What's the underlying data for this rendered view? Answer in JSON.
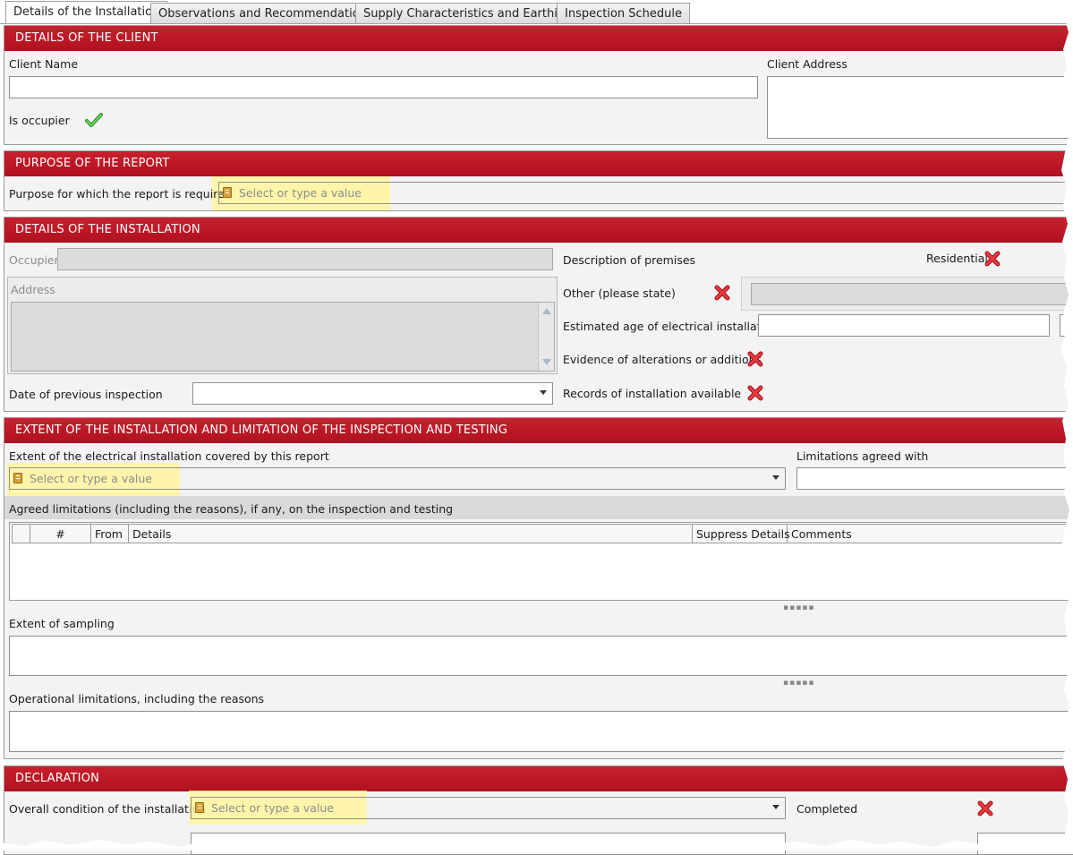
{
  "tabs": [
    {
      "label": "Details of the Installation",
      "active": true
    },
    {
      "label": "Observations and Recommendations",
      "active": false
    },
    {
      "label": "Supply Characteristics and Earthing",
      "active": false
    },
    {
      "label": "Inspection Schedule",
      "active": false
    }
  ],
  "client": {
    "header": "DETAILS OF THE CLIENT",
    "name_label": "Client Name",
    "name_value": "",
    "address_label": "Client Address",
    "address_value": "",
    "occupier_label": "Is occupier",
    "occupier_checked": true
  },
  "purpose": {
    "header": "PURPOSE OF THE REPORT",
    "label": "Purpose for which the report is required",
    "placeholder": "Select or type a value"
  },
  "installation": {
    "header": "DETAILS OF THE INSTALLATION",
    "occupier_label": "Occupier",
    "address_label": "Address",
    "prev_inspection_label": "Date of previous inspection",
    "prev_inspection_value": "",
    "premises_label": "Description of premises",
    "residential_label": "Residential",
    "other_label": "Other (please state)",
    "age_label": "Estimated age of electrical installation",
    "age_value": "",
    "alterations_label": "Evidence of alterations or additions",
    "records_label": "Records of installation available"
  },
  "extent": {
    "header": "EXTENT OF THE INSTALLATION AND LIMITATION OF THE INSPECTION AND TESTING",
    "covered_label": "Extent of the electrical installation covered by this report",
    "covered_placeholder": "Select or type a value",
    "agreed_with_label": "Limitations agreed with",
    "agreed_limitations_label": "Agreed limitations (including the reasons), if any, on the inspection and testing",
    "columns": [
      "#",
      "From",
      "Details",
      "Suppress Details",
      "Comments"
    ],
    "rows": [],
    "sampling_label": "Extent of sampling",
    "operational_label": "Operational limitations, including the reasons"
  },
  "declaration": {
    "header": "DECLARATION",
    "condition_label": "Overall condition of the installation",
    "condition_placeholder": "Select or type a value",
    "completed_label": "Completed"
  },
  "colors": {
    "header_red": "#b81525",
    "highlight": "#fff59d",
    "check_green": "#3aa335",
    "x_red": "#d8202a"
  }
}
